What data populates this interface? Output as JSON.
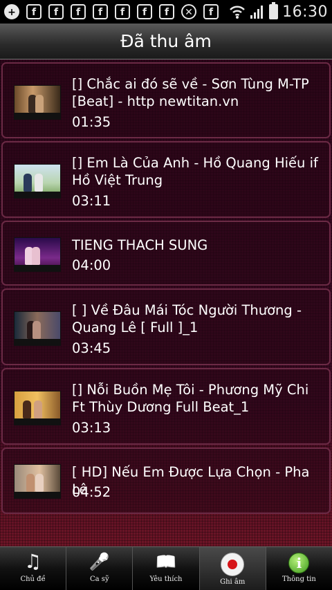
{
  "status_bar": {
    "time": "16:30",
    "notification_icons": [
      "plus-icon",
      "facebook-icon",
      "facebook-icon",
      "facebook-icon",
      "facebook-icon",
      "facebook-icon",
      "facebook-icon",
      "facebook-icon",
      "circle-x-icon",
      "facebook-icon"
    ],
    "icon_glyphs": {
      "plus": "+",
      "facebook": "f",
      "circle_x": "✕"
    }
  },
  "header": {
    "title": "Đã thu âm"
  },
  "recordings": [
    {
      "title": "[] Chắc ai đó sẽ về - Sơn Tùng M-TP [Beat] - http newtitan.vn",
      "duration": "01:35"
    },
    {
      "title": "[] Em Là Của Anh - Hồ Quang Hiếu if Hồ Việt Trung",
      "duration": "03:11"
    },
    {
      "title": "TIENG THACH SUNG",
      "duration": "04:00"
    },
    {
      "title": "[ ] Về Đâu Mái Tóc Người Thương - Quang Lê [ Full ]_1",
      "duration": "03:45"
    },
    {
      "title": "[] Nỗi Buồn Mẹ Tôi - Phương Mỹ Chi Ft Thùy Dương Full Beat_1",
      "duration": "03:13"
    },
    {
      "title": "[ HD] Nếu Em Được Lựa Chọn - Pha Lê",
      "duration": "04:52"
    }
  ],
  "bottom_nav": [
    {
      "label": "Chủ đề",
      "icon": "music-note-icon",
      "glyph": "♫"
    },
    {
      "label": "Ca sỹ",
      "icon": "microphone-icon",
      "glyph": "🎤"
    },
    {
      "label": "Yêu thích",
      "icon": "book-icon",
      "glyph": "📖"
    },
    {
      "label": "Ghi âm",
      "icon": "record-icon",
      "glyph": ""
    },
    {
      "label": "Thông tin",
      "icon": "info-icon",
      "glyph": "i"
    }
  ],
  "colors": {
    "background": "#3b0a22",
    "item_border": "#6b2a45",
    "record_red": "#d61418",
    "info_green": "#3d9a1c"
  }
}
